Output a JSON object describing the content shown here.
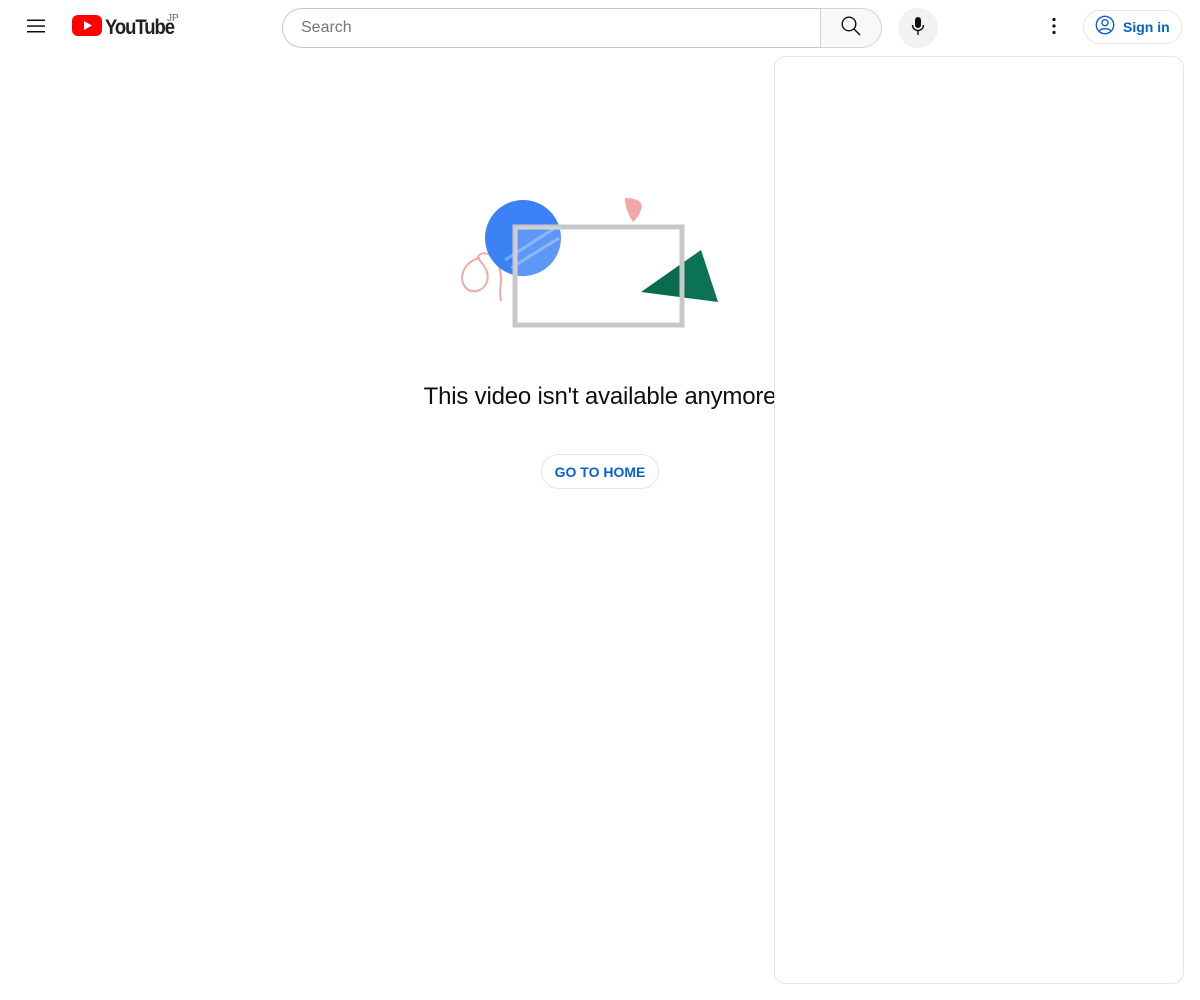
{
  "header": {
    "logo_text": "YouTube",
    "country_code": "JP",
    "search": {
      "placeholder": "Search",
      "value": ""
    },
    "sign_in_label": "Sign in"
  },
  "error": {
    "message": "This video isn't available anymore",
    "home_button_label": "GO TO HOME"
  },
  "colors": {
    "brand_red": "#ff0000",
    "link_blue": "#065fd4",
    "illustration_blue": "#3b82f6",
    "illustration_green": "#0b6b50",
    "illustration_pink": "#f4a7a7"
  },
  "icons": {
    "menu": "hamburger-menu-icon",
    "logo": "youtube-play-icon",
    "search": "magnifier-icon",
    "voice": "microphone-icon",
    "more": "vertical-dots-icon",
    "account": "account-circle-icon"
  }
}
